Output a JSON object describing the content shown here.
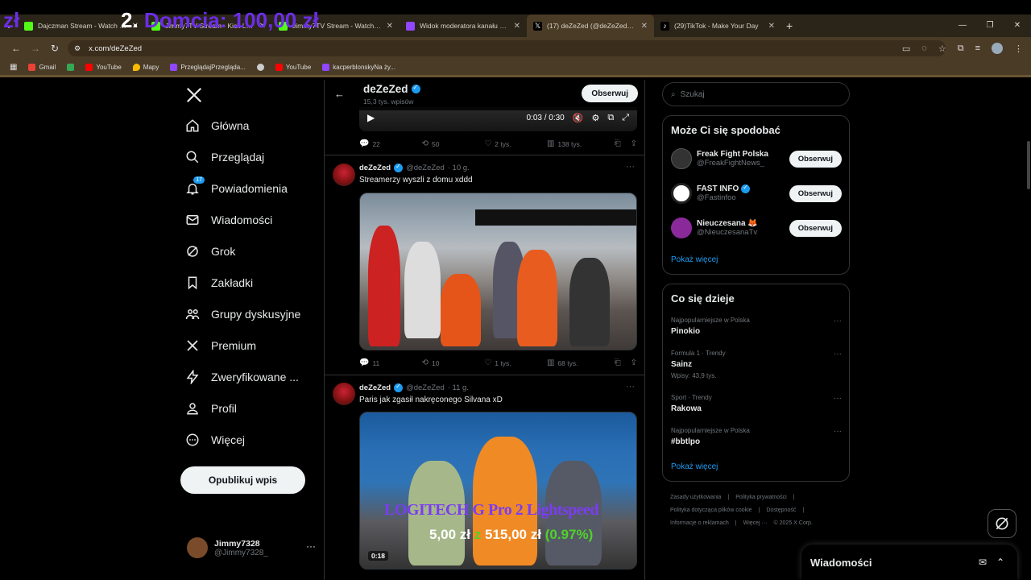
{
  "overlay": {
    "zl": "zł",
    "home_num": "2.",
    "home_rest": "Domcia: 100,00 zł",
    "product": "LOGITECH G Pro 2 Lightspeed",
    "price_raised": "5,00 zł",
    "price_of": "z",
    "price_goal": "515,00 zł",
    "price_percent": "(0.97%)"
  },
  "browser": {
    "tabs": [
      {
        "label": "Dajczman Stream - Watch Live",
        "color": "#53fc18"
      },
      {
        "label": "Jimmy7TV Stream - Kick Live",
        "color": "#53fc18"
      },
      {
        "label": "Jimmy7TV Stream - Watch Live",
        "color": "#53fc18"
      },
      {
        "label": "Widok moderatora kanału Jimm",
        "color": "#9146ff"
      },
      {
        "label": "(17) deZeZed (@deZeZed) / X",
        "color": "#000000"
      },
      {
        "label": "(29)TikTok - Make Your Day",
        "color": "#000000"
      }
    ],
    "url": "x.com/deZeZed",
    "bookmarks": [
      {
        "label": "Gmail",
        "color": "#ea4335"
      },
      {
        "label": "",
        "color": "#34a853"
      },
      {
        "label": "YouTube",
        "color": "#ff0000"
      },
      {
        "label": "Mapy",
        "color": "#fbbc04"
      },
      {
        "label": "PrzeglądajPrzegląda...",
        "color": "#9146ff"
      },
      {
        "label": "",
        "color": "#cccccc"
      },
      {
        "label": "YouTube",
        "color": "#ff0000"
      },
      {
        "label": "kacperblonskyNa ży...",
        "color": "#9146ff"
      }
    ]
  },
  "nav": {
    "items": [
      {
        "label": "Główna",
        "icon": "home-icon"
      },
      {
        "label": "Przeglądaj",
        "icon": "search-icon"
      },
      {
        "label": "Powiadomienia",
        "icon": "bell-icon",
        "badge": "17"
      },
      {
        "label": "Wiadomości",
        "icon": "mail-icon"
      },
      {
        "label": "Grok",
        "icon": "grok-icon"
      },
      {
        "label": "Zakładki",
        "icon": "bookmark-icon"
      },
      {
        "label": "Grupy dyskusyjne",
        "icon": "communities-icon"
      },
      {
        "label": "Premium",
        "icon": "x-logo-icon"
      },
      {
        "label": "Zweryfikowane ...",
        "icon": "lightning-icon"
      },
      {
        "label": "Profil",
        "icon": "profile-icon"
      },
      {
        "label": "Więcej",
        "icon": "more-circle-icon"
      }
    ],
    "post_button": "Opublikuj wpis",
    "user_name": "Jimmy7328",
    "user_handle": "@Jimmy7328_",
    "user_more": "···"
  },
  "profile": {
    "name": "deZeZed",
    "posts": "15,3 tys. wpisów",
    "follow": "Obserwuj"
  },
  "video1": {
    "time": "0:03 / 0:30"
  },
  "tweets": [
    {
      "actions": {
        "replies": "22",
        "reposts": "50",
        "likes": "2 tys.",
        "views": "138 tys."
      }
    },
    {
      "name": "deZeZed",
      "handle": "@deZeZed",
      "time": "· 10 g.",
      "text": "Streamerzy wyszli z domu xddd",
      "actions": {
        "replies": "11",
        "reposts": "10",
        "likes": "1 tys.",
        "views": "68 tys."
      }
    },
    {
      "name": "deZeZed",
      "handle": "@deZeZed",
      "time": "· 11 g.",
      "text": "Paris jak zgasił nakręconego Silvana xD",
      "video_time": "0:18"
    }
  ],
  "sidebar": {
    "search_placeholder": "Szukaj",
    "suggest_title": "Może Ci się spodobać",
    "suggestions": [
      {
        "name": "Freak Fight Polska",
        "handle": "@FreakFightNews_",
        "verified": false,
        "color": "#333333"
      },
      {
        "name": "FAST INFO",
        "handle": "@Fastinfoo",
        "verified": true,
        "color": "#ffffff"
      },
      {
        "name": "Nieuczesana 🦊",
        "handle": "@NieuczesanaTv",
        "verified": false,
        "color": "#8a2a9a"
      }
    ],
    "follow_label": "Obserwuj",
    "show_more": "Pokaż więcej",
    "trends_title": "Co się dzieje",
    "trends": [
      {
        "cat": "Najpopularniejsze w Polska",
        "name": "Pinokio",
        "posts": ""
      },
      {
        "cat": "Formula 1 · Trendy",
        "name": "Sainz",
        "posts": "Wpisy: 43,9 tys."
      },
      {
        "cat": "Sport · Trendy",
        "name": "Rakowa",
        "posts": ""
      },
      {
        "cat": "Najpopularniejsze w Polska",
        "name": "#bbtlpo",
        "posts": ""
      }
    ],
    "trends_more": "Pokaż więcej",
    "footer": [
      "Zasady użytkowania",
      "|",
      "Polityka prywatności",
      "|",
      "Polityka dotycząca plików cookie",
      "|",
      "Dostępność",
      "|",
      "Informacje o reklamach",
      "|",
      "Więcej ···",
      "© 2025 X Corp."
    ]
  },
  "dm": {
    "title": "Wiadomości"
  }
}
